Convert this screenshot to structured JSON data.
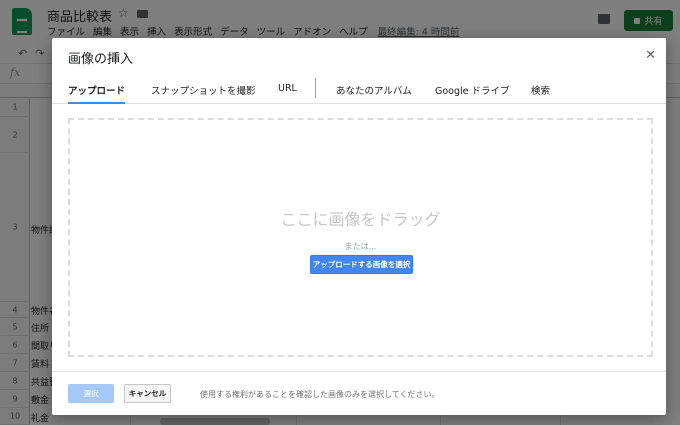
{
  "app": {
    "doc_title": "商品比較表",
    "menus": [
      "ファイル",
      "編集",
      "表示",
      "挿入",
      "表示形式",
      "データ",
      "ツール",
      "アドオン",
      "ヘルプ"
    ],
    "last_edit": "最終編集: 4 時間前",
    "share_label": "共有",
    "brand_color": "#0f9d58",
    "share_color": "#188038"
  },
  "toolbar": {
    "fx_label": "fx"
  },
  "sheet": {
    "rows": [
      {
        "num": "1",
        "cell": ""
      },
      {
        "num": "2",
        "cell": ""
      },
      {
        "num": "3",
        "cell": "物件説"
      },
      {
        "num": "4",
        "cell": "物件名"
      },
      {
        "num": "5",
        "cell": "住所"
      },
      {
        "num": "6",
        "cell": "間取り"
      },
      {
        "num": "7",
        "cell": "賃料"
      },
      {
        "num": "8",
        "cell": "共益費"
      },
      {
        "num": "9",
        "cell": "敷金"
      },
      {
        "num": "10",
        "cell": "礼金"
      }
    ]
  },
  "dialog": {
    "title": "画像の挿入",
    "tabs": [
      {
        "label": "アップロード",
        "active": true
      },
      {
        "label": "スナップショットを撮影",
        "active": false
      },
      {
        "label": "URL",
        "active": false
      },
      {
        "label": "あなたのアルバム",
        "active": false
      },
      {
        "label": "Google ドライブ",
        "active": false
      },
      {
        "label": "検索",
        "active": false
      }
    ],
    "drop_text": "ここに画像をドラッグ",
    "or_text": "または...",
    "upload_button": "アップロードする画像を選択",
    "select_button": "選択",
    "cancel_button": "キャンセル",
    "footer_note": "使用する権利があることを確認した画像のみを選択してください。",
    "accent_color": "#4285f4"
  }
}
